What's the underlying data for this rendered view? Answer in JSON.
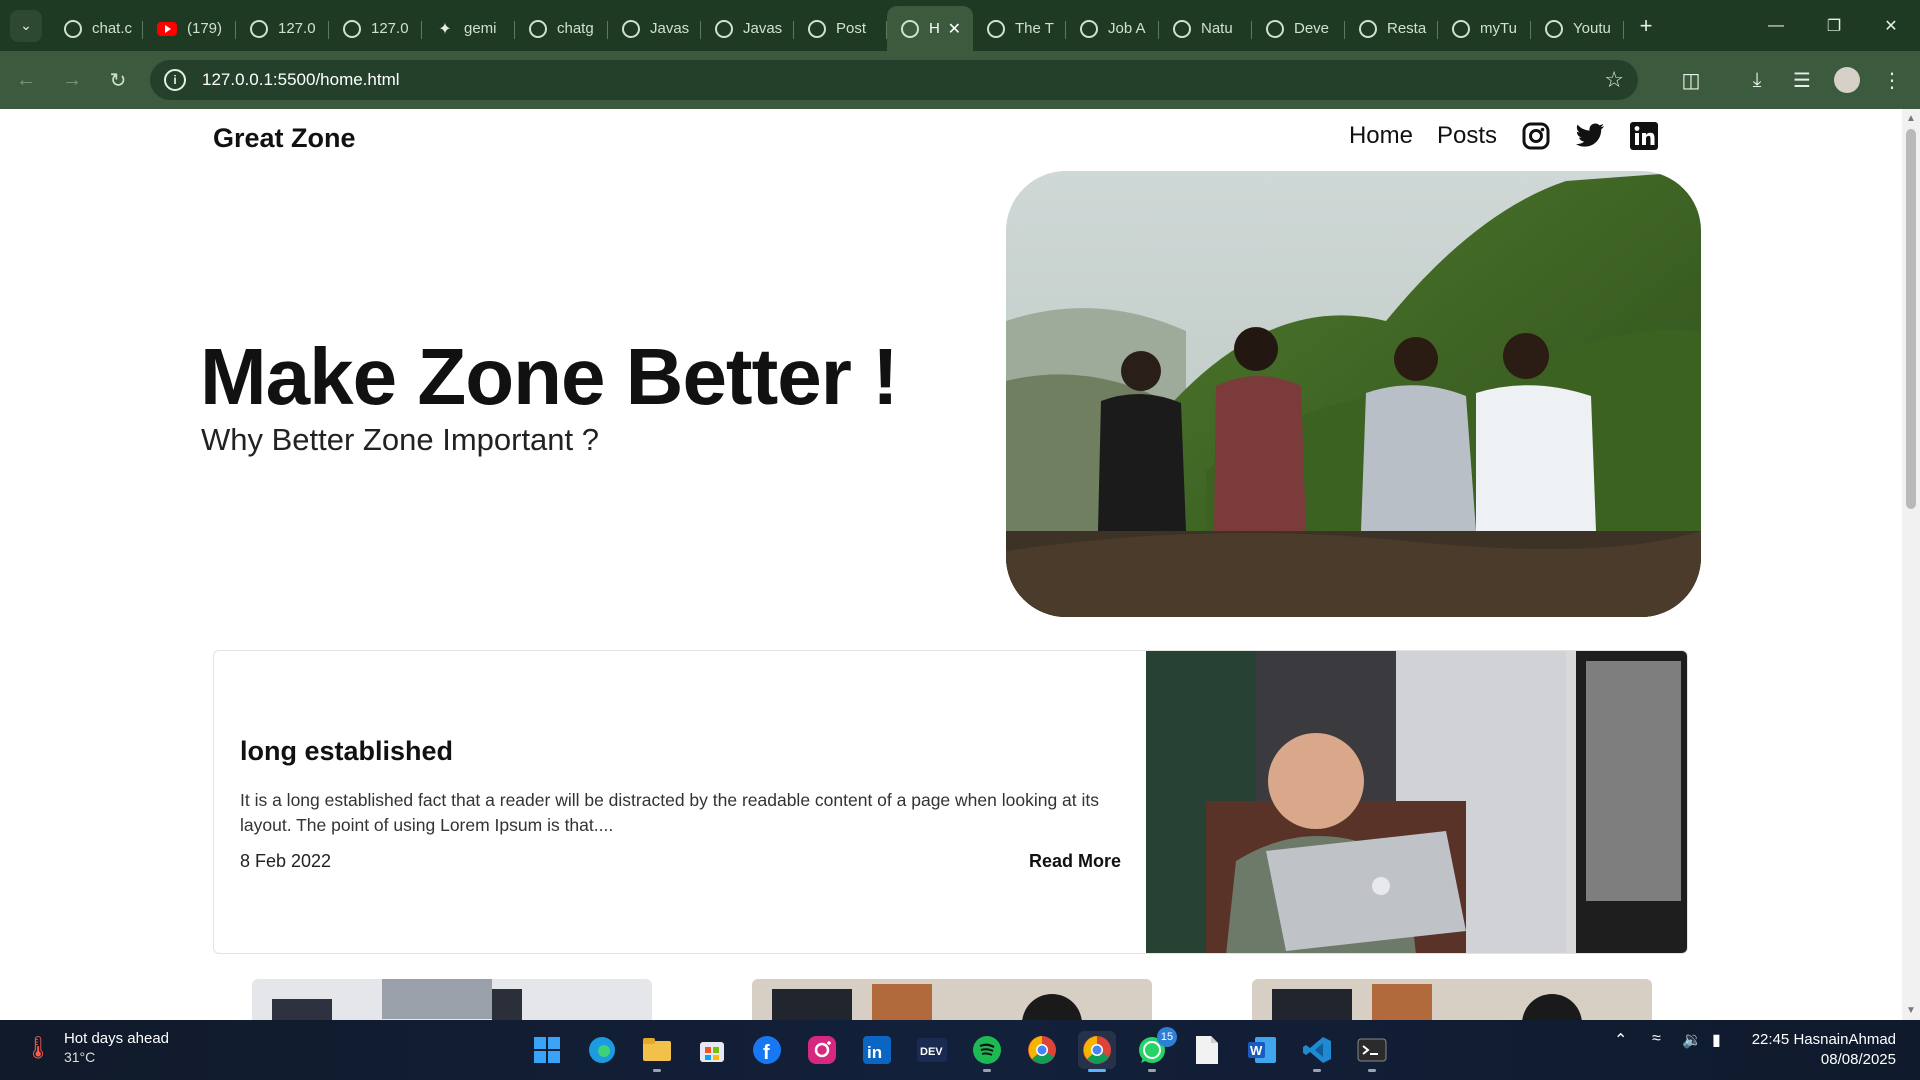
{
  "browser": {
    "tabs": [
      {
        "label": "chat.c",
        "favicon": "chatbot-icon"
      },
      {
        "label": "(179)",
        "favicon": "youtube-icon"
      },
      {
        "label": "127.0",
        "favicon": "globe-icon"
      },
      {
        "label": "127.0",
        "favicon": "globe-icon"
      },
      {
        "label": "gemi",
        "favicon": "gemini-icon"
      },
      {
        "label": "chatg",
        "favicon": "chatgpt-icon"
      },
      {
        "label": "Javas",
        "favicon": "globe-icon"
      },
      {
        "label": "Javas",
        "favicon": "globe-icon"
      },
      {
        "label": "Post",
        "favicon": "globe-icon"
      },
      {
        "label": "H",
        "favicon": "globe-icon",
        "active": true
      },
      {
        "label": "The T",
        "favicon": "globe-icon"
      },
      {
        "label": "Job A",
        "favicon": "globe-icon"
      },
      {
        "label": "Natu",
        "favicon": "globe-icon"
      },
      {
        "label": "Deve",
        "favicon": "globe-icon"
      },
      {
        "label": "Resta",
        "favicon": "globe-icon"
      },
      {
        "label": "myTu",
        "favicon": "globe-icon"
      },
      {
        "label": "Youtu",
        "favicon": "globe-icon"
      }
    ],
    "url": "127.0.0.1:5500/home.html",
    "theme_color": "#3b5a3e"
  },
  "site": {
    "brand": "Great Zone",
    "nav": {
      "home": "Home",
      "posts": "Posts"
    },
    "social_icons": [
      "instagram-icon",
      "twitter-icon",
      "linkedin-icon"
    ]
  },
  "hero": {
    "title": "Make Zone Better !",
    "subtitle": "Why Better Zone Important ?"
  },
  "featured_post": {
    "title": "long established",
    "excerpt": "It is a long established fact that a reader will be distracted by the readable content of a page when looking at its layout. The point of using Lorem Ipsum is that....",
    "date": "8 Feb 2022",
    "read_more": "Read More"
  },
  "taskbar": {
    "weather_title": "Hot days ahead",
    "weather_temp": "31°C",
    "whatsapp_badge": "15",
    "user": "HasnainAhmad",
    "time": "22:45",
    "date": "08/08/2025"
  }
}
